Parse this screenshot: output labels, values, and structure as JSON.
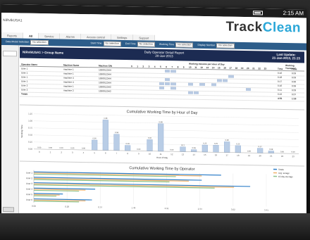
{
  "status_bar": {
    "time": "2:15 AM"
  },
  "app": {
    "window_title": "NiRvlkUSA1",
    "logo_part1": "Track",
    "logo_part2": "Clean",
    "tabs": [
      "Reports",
      "All",
      "Service",
      "Alarms",
      "Access control",
      "Settings",
      "Support"
    ]
  },
  "filters": [
    {
      "label": "Data Model Selection",
      "value": "No selection"
    },
    {
      "label": "Start Time",
      "value": "No selection"
    },
    {
      "label": "End Time",
      "value": "No selection"
    },
    {
      "label": "Working Time",
      "value": "No selection"
    },
    {
      "label": "Display Number",
      "value": "No selection"
    }
  ],
  "report": {
    "breadcrumb": "NiRvlkUSA1 > Group Name",
    "title_line1": "Daily Operator Detail Report",
    "title_line2": "20-Jan-2013",
    "update_line1": "Last Update:",
    "update_line2": "21-Jan-2013, 21:15",
    "table": {
      "group_header": "Working minutes per Hour of Day",
      "summary_group": "Working  Transport",
      "headers": [
        "Operator Name",
        "Machine Name",
        "Machine S/N",
        "0",
        "1",
        "2",
        "3",
        "4",
        "5",
        "6",
        "7",
        "8",
        "9",
        "10",
        "11",
        "12",
        "13",
        "14",
        "15",
        "16",
        "17",
        "18",
        "19",
        "20",
        "21",
        "22",
        "23",
        "Time",
        "Time"
      ],
      "rows": [
        {
          "op": "User 1",
          "machine": "machine 1",
          "sn": "1000012344",
          "time": "0:16",
          "transport": "0:03",
          "hours": [
            6,
            7
          ]
        },
        {
          "op": "User 1",
          "machine": "machine 1",
          "sn": "1000012344",
          "time": "0:18",
          "transport": "0:03",
          "hours": [
            17
          ]
        },
        {
          "op": "User 1",
          "machine": "machine 4",
          "sn": "1000012344",
          "time": "0:17",
          "transport": "0:00",
          "hours": [
            6,
            15,
            16
          ]
        },
        {
          "op": "User 1",
          "machine": "machine 4",
          "sn": "1000012344",
          "time": "0:16",
          "transport": "0:06",
          "hours": [
            5,
            6,
            7,
            10,
            12,
            14
          ]
        },
        {
          "op": "User 2",
          "machine": "machine 1",
          "sn": "1000012342",
          "time": "0:11",
          "transport": "0:03",
          "hours": [
            5,
            7,
            20
          ]
        },
        {
          "op": "User 2",
          "machine": "machine 2",
          "sn": "1000012342",
          "time": "0:19",
          "transport": "0:07",
          "hours": [
            10,
            11
          ]
        }
      ],
      "totals_label": "Totals",
      "total_time": "4:01",
      "total_transport": "1:16"
    }
  },
  "chart_data": [
    {
      "type": "bar",
      "title": "Cumulative Working Time by Hour of Day",
      "xlabel": "Hour of Day",
      "ylabel": "Working Time",
      "categories": [
        "0",
        "1",
        "2",
        "3",
        "4",
        "5",
        "6",
        "7",
        "8",
        "9",
        "10",
        "11",
        "12",
        "13",
        "14",
        "15",
        "16",
        "17",
        "18",
        "19",
        "20",
        "21",
        "22",
        "23"
      ],
      "values": [
        0,
        0,
        0,
        0,
        0,
        0.36,
        1.08,
        0.58,
        0.19,
        0,
        0.41,
        0.98,
        0,
        0.17,
        0.08,
        0.25,
        0.25,
        0.38,
        0.25,
        0,
        0.17,
        0.08,
        0,
        0
      ],
      "value_labels": [
        "0.00",
        "0.00",
        "0.00",
        "0.00",
        "0.00",
        "0.36",
        "1.08",
        "0.58",
        "0.19",
        "0.00",
        "0.41",
        "0.98",
        "0.00",
        "0.17",
        "0.08",
        "0.25",
        "0.25",
        "0.38",
        "0.25",
        "0.00",
        "0.17",
        "0.08",
        "0.00",
        "0.00"
      ],
      "ylim": [
        0,
        1.25
      ],
      "yticks": [
        "0.00",
        "0.25",
        "0.50",
        "0.75",
        "1.00",
        "1.25"
      ],
      "grid": true,
      "colors": {
        "bar": "#b9cde6",
        "bar_edge": "#7f9fc8"
      }
    },
    {
      "type": "bar",
      "title": "Cumulative Working Time by Operator",
      "orientation": "horizontal",
      "categories": [
        "User 1",
        "User 2",
        "User 3",
        "User 4",
        "User 5",
        "User 6"
      ],
      "series": [
        {
          "name": "Totals",
          "values": [
            2.9,
            2.6,
            3.35,
            0.95,
            0.45,
            0.9
          ],
          "color": "#2f7fc9"
        },
        {
          "name": "Avg: avrage",
          "values": [
            2.6,
            2.4,
            3.1,
            0.8,
            0.4,
            0.8
          ],
          "color": "#f0b26b"
        },
        {
          "name": "10-day average",
          "values": [
            2.2,
            2.1,
            2.8,
            0.7,
            0.35,
            0.7
          ],
          "color": "#8bc28b"
        }
      ],
      "xticks": [
        "0.00",
        "0.28",
        "0.57",
        "1.46",
        "2.91",
        "2.34",
        "3.02",
        "3.41"
      ],
      "xlim": [
        0,
        3.6
      ],
      "legend": "top-right"
    }
  ]
}
